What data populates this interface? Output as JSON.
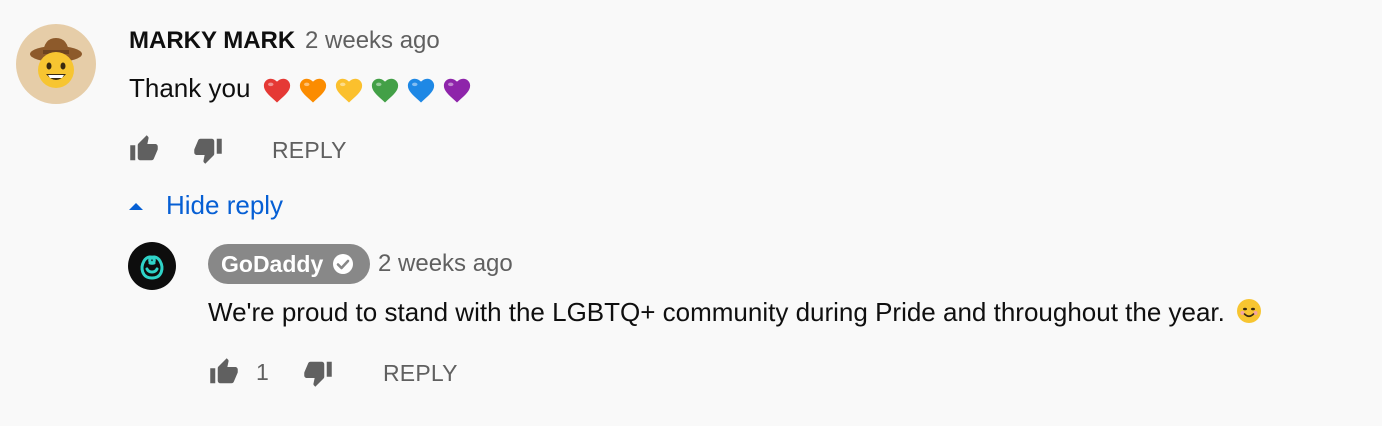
{
  "comment": {
    "author": "MARKY MARK",
    "time": "2 weeks ago",
    "text": "Thank you",
    "hearts": [
      "#e53935",
      "#fb8c00",
      "#fbc02d",
      "#43a047",
      "#1e88e5",
      "#8e24aa"
    ],
    "avatar_icon": "cowboy-face-icon",
    "actions": {
      "reply_label": "REPLY"
    }
  },
  "toggle": {
    "label": "Hide reply",
    "icon": "caret-up-icon"
  },
  "reply": {
    "author": "GoDaddy",
    "verified_icon": "verified-check-icon",
    "time": "2 weeks ago",
    "text": "We're proud to stand with the LGBTQ+ community during Pride and throughout the year.",
    "emoji_icon": "smiling-face-icon",
    "avatar_icon": "godaddy-logo-icon",
    "likes": "1",
    "actions": {
      "reply_label": "REPLY"
    }
  },
  "colors": {
    "link": "#065fd4",
    "muted": "#606060",
    "chip": "#888888"
  }
}
